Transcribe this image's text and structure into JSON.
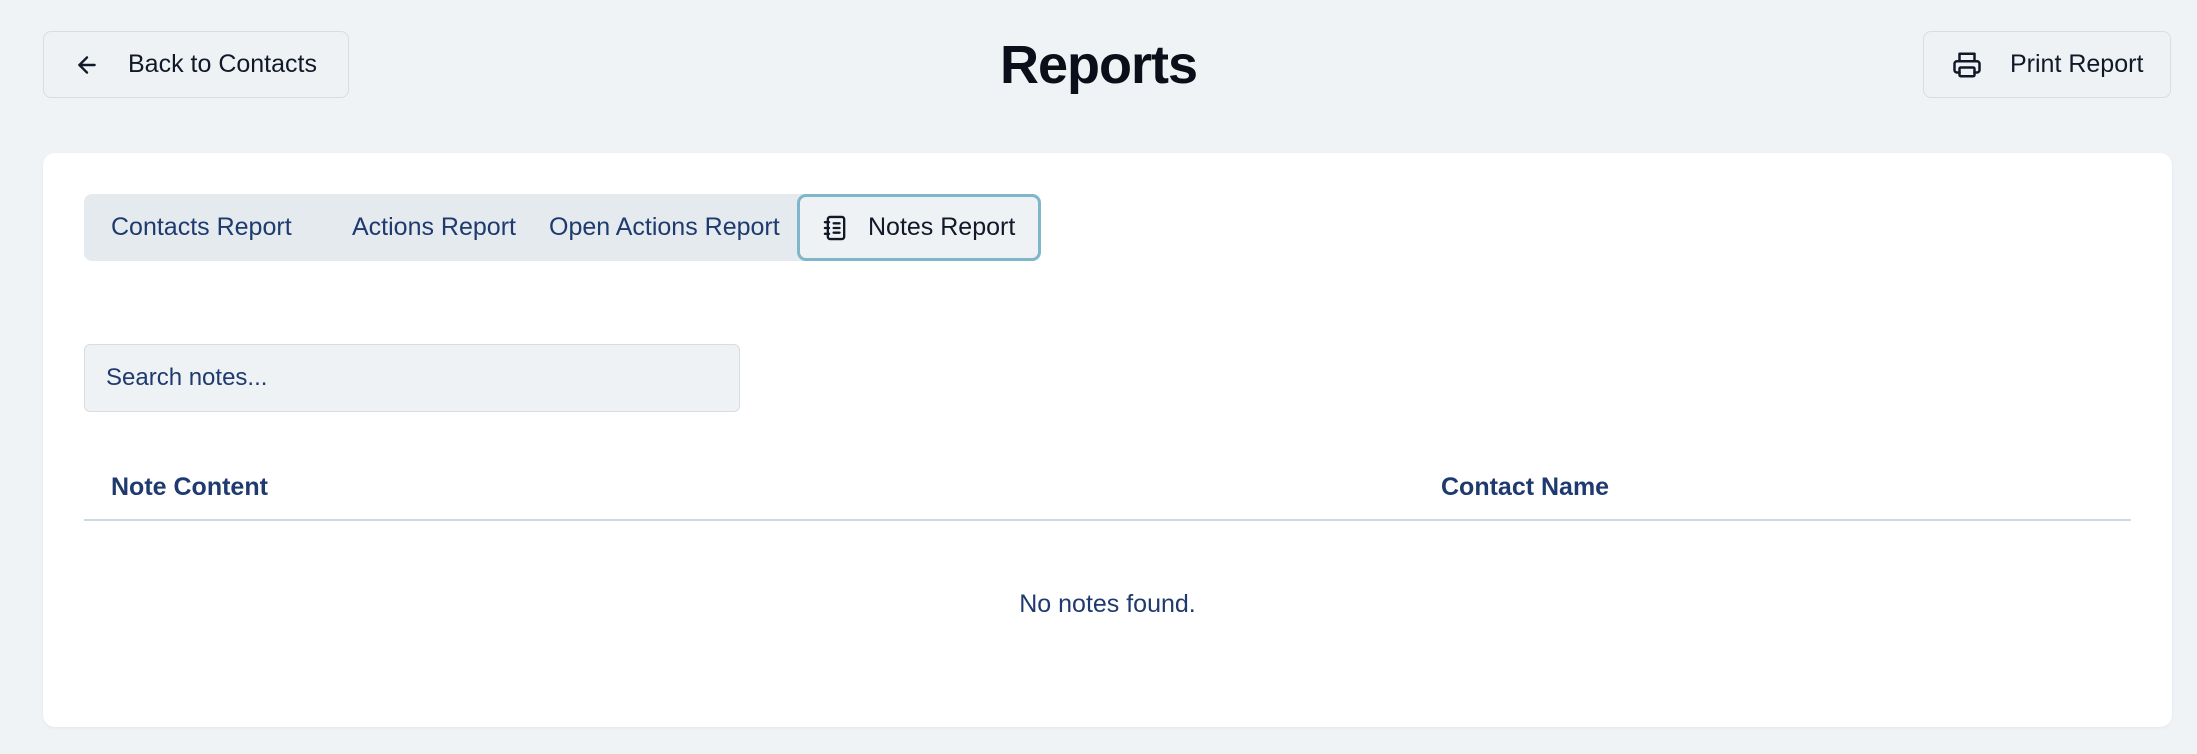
{
  "header": {
    "title": "Reports",
    "back_label": "Back to Contacts",
    "print_label": "Print Report"
  },
  "tabs": [
    {
      "label": "Contacts Report",
      "active": false
    },
    {
      "label": "Actions Report",
      "active": false
    },
    {
      "label": "Open Actions Report",
      "active": false
    },
    {
      "label": "Notes Report",
      "active": true,
      "icon": "notebook-icon"
    }
  ],
  "search": {
    "placeholder": "Search notes...",
    "value": ""
  },
  "table": {
    "columns": [
      "Note Content",
      "Contact Name"
    ],
    "rows": [],
    "empty_message": "No notes found."
  },
  "colors": {
    "page_bg": "#eff3f6",
    "card_bg": "#ffffff",
    "text_navy": "#1e3a6e",
    "active_tab_border": "#7fb6c9",
    "tab_bar_bg": "#e4eaee"
  },
  "icons": {
    "back": "arrow-left-icon",
    "print": "printer-icon",
    "notes_tab": "notebook-icon"
  }
}
